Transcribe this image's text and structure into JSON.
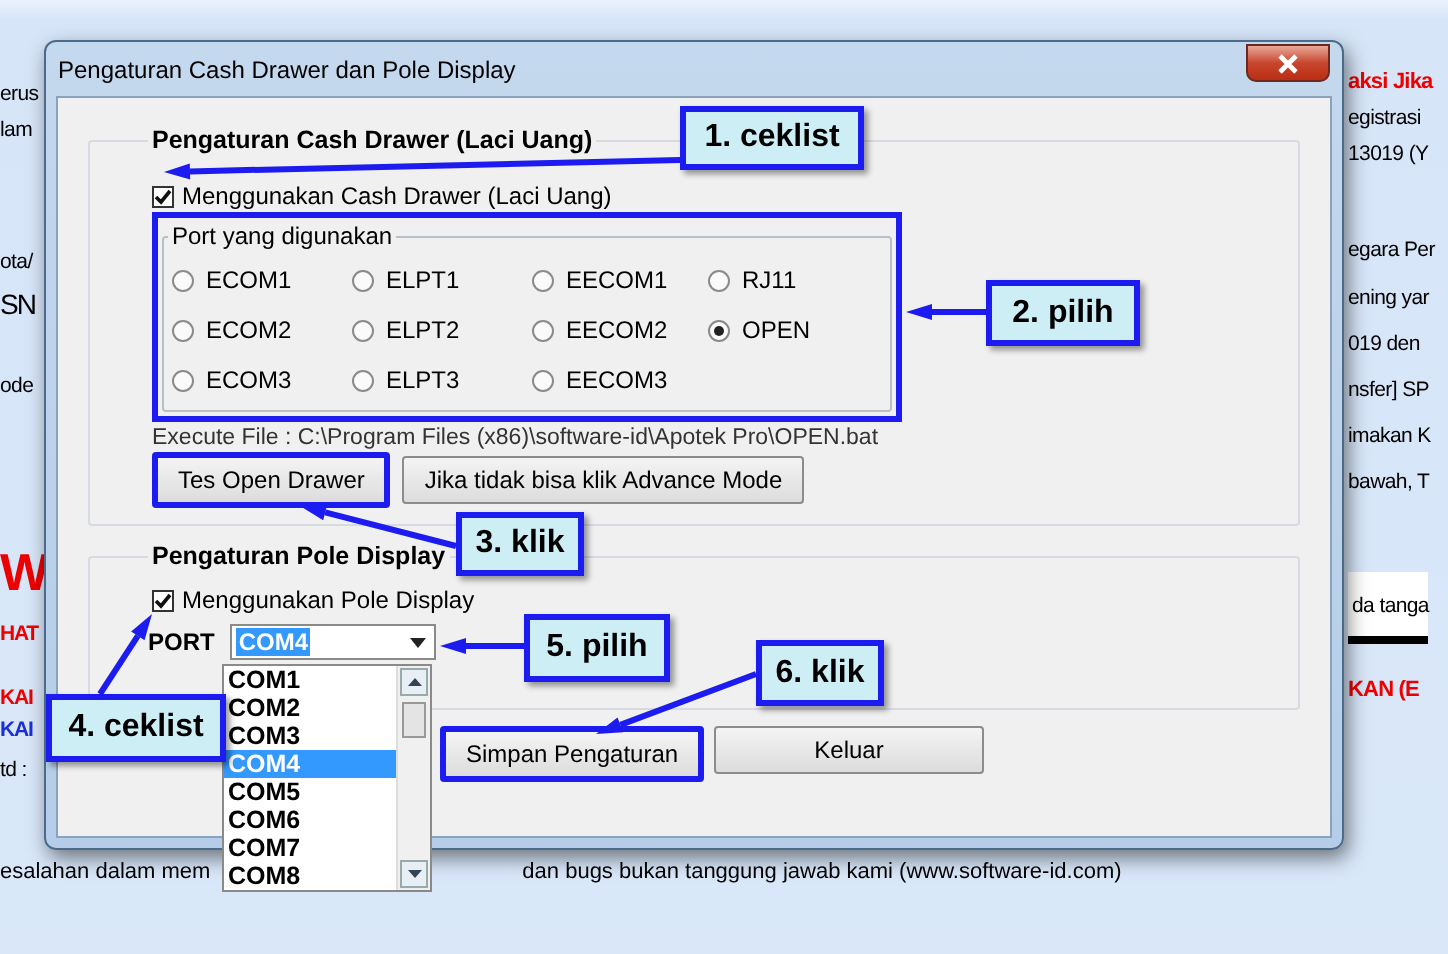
{
  "background": {
    "left_fragments": [
      {
        "text": "erus",
        "kind": "normal"
      },
      {
        "text": "lam",
        "kind": "normal"
      },
      {
        "text": "ota/",
        "kind": "normal"
      },
      {
        "text": "SN",
        "kind": "large"
      },
      {
        "text": "ode",
        "kind": "normal"
      },
      {
        "text": "W",
        "kind": "huge-red"
      },
      {
        "text": "HAT",
        "kind": "red-bold"
      },
      {
        "text": "KAI",
        "kind": "red-bold"
      },
      {
        "text": "KAI",
        "kind": "blue-bold"
      },
      {
        "text": "td :",
        "kind": "normal"
      }
    ],
    "right_fragments": [
      {
        "text": "aksi Jika",
        "kind": "red-bold"
      },
      {
        "text": "egistrasi",
        "kind": "normal"
      },
      {
        "text": "13019 (Y",
        "kind": "normal"
      },
      {
        "text": "egara Per",
        "kind": "normal"
      },
      {
        "text": "ening yar",
        "kind": "normal"
      },
      {
        "text": "019 den",
        "kind": "normal"
      },
      {
        "text": "nsfer] SP",
        "kind": "normal"
      },
      {
        "text": "imakan K",
        "kind": "normal"
      },
      {
        "text": "bawah, T",
        "kind": "normal"
      },
      {
        "text": "da tanga",
        "kind": "boxed"
      },
      {
        "text": "KAN (E",
        "kind": "red-bold"
      }
    ],
    "footer_fragments": [
      {
        "text": "esalahan dalam mem"
      },
      {
        "text": "dan bugs bukan tanggung jawab kami (www.software-id.com)"
      }
    ]
  },
  "dialog": {
    "title": "Pengaturan Cash Drawer dan Pole Display",
    "cash_drawer": {
      "title": "Pengaturan Cash Drawer (Laci Uang)",
      "checkbox": {
        "label": "Menggunakan Cash Drawer (Laci Uang)",
        "checked": true
      },
      "port_group": {
        "title": "Port yang digunakan",
        "highlighted": true,
        "options": [
          {
            "label": "ECOM1",
            "selected": false
          },
          {
            "label": "ELPT1",
            "selected": false
          },
          {
            "label": "EECOM1",
            "selected": false
          },
          {
            "label": "RJ11",
            "selected": false
          },
          {
            "label": "ECOM2",
            "selected": false
          },
          {
            "label": "ELPT2",
            "selected": false
          },
          {
            "label": "EECOM2",
            "selected": false
          },
          {
            "label": "OPEN",
            "selected": true
          },
          {
            "label": "ECOM3",
            "selected": false
          },
          {
            "label": "ELPT3",
            "selected": false
          },
          {
            "label": "EECOM3",
            "selected": false
          }
        ]
      },
      "execute_file": "Execute File : C:\\Program Files (x86)\\software-id\\Apotek Pro\\OPEN.bat",
      "buttons": [
        {
          "label": "Tes Open Drawer",
          "highlighted": true
        },
        {
          "label": "Jika tidak bisa klik Advance Mode",
          "highlighted": false
        }
      ]
    },
    "pole_display": {
      "title": "Pengaturan Pole Display",
      "checkbox": {
        "label": "Menggunakan Pole Display",
        "checked": true
      },
      "port_label": "PORT",
      "port_value": "COM4",
      "port_list": [
        {
          "label": "COM1",
          "selected": false
        },
        {
          "label": "COM2",
          "selected": false
        },
        {
          "label": "COM3",
          "selected": false
        },
        {
          "label": "COM4",
          "selected": true
        },
        {
          "label": "COM5",
          "selected": false
        },
        {
          "label": "COM6",
          "selected": false
        },
        {
          "label": "COM7",
          "selected": false
        },
        {
          "label": "COM8",
          "selected": false
        }
      ]
    },
    "buttons": [
      {
        "label": "Simpan Pengaturan",
        "highlighted": true
      },
      {
        "label": "Keluar",
        "highlighted": false
      }
    ]
  },
  "annotations": [
    {
      "label": "1. ceklist"
    },
    {
      "label": "2. pilih"
    },
    {
      "label": "3. klik"
    },
    {
      "label": "4. ceklist"
    },
    {
      "label": "5. pilih"
    },
    {
      "label": "6. klik"
    }
  ]
}
